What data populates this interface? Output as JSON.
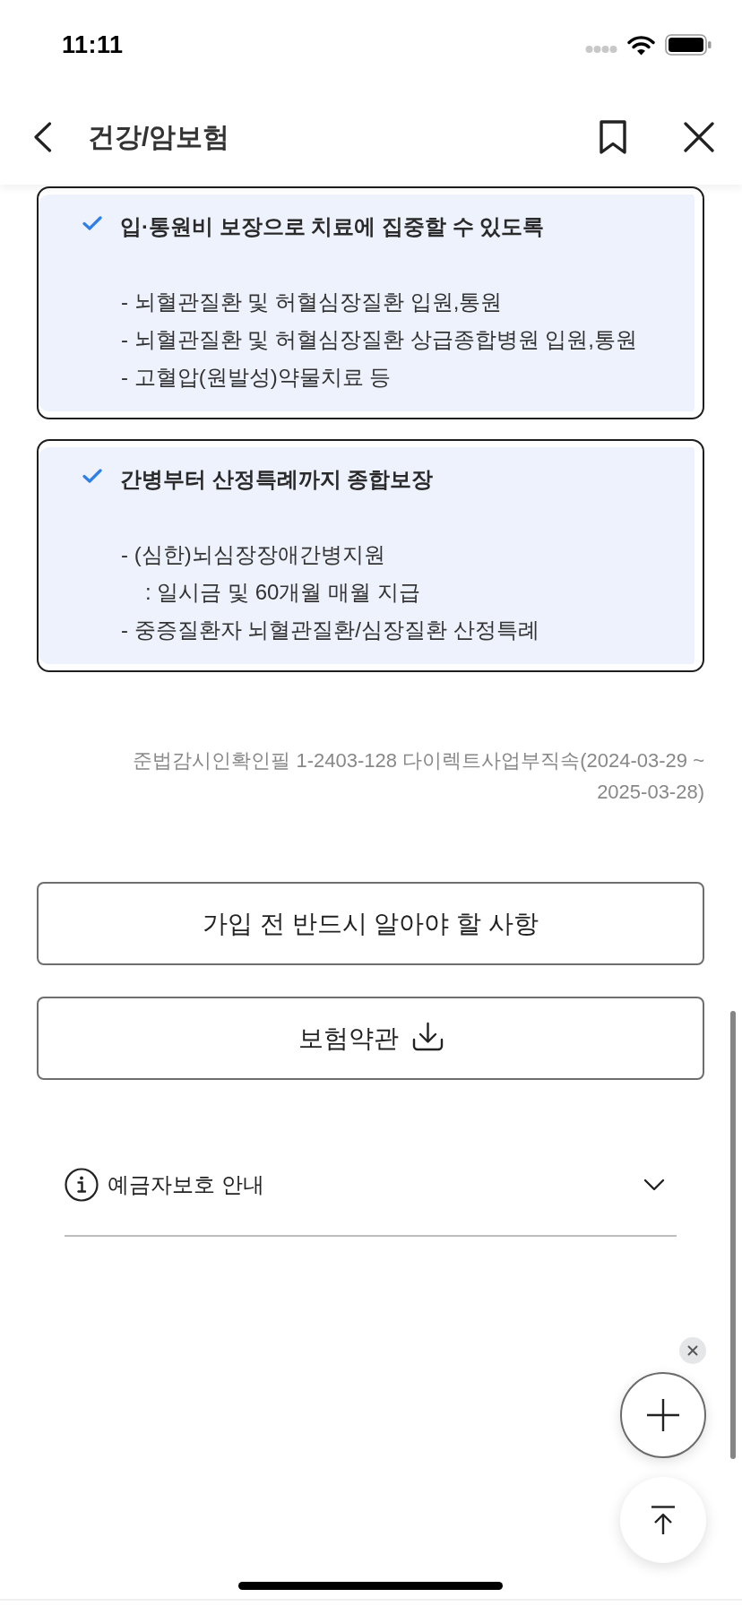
{
  "status_bar": {
    "time": "11:11"
  },
  "header": {
    "title": "건강/암보험",
    "bookmarked": false
  },
  "cards": [
    {
      "title": "입·통원비 보장으로 치료에 집중할 수 있도록",
      "lines": [
        {
          "kind": "bullet",
          "text": "- 뇌혈관질환 및 허혈심장질환 입원,통원"
        },
        {
          "kind": "bullet",
          "text": "- 뇌혈관질환 및 허혈심장질환 상급종합병원 입원,통원"
        },
        {
          "kind": "bullet",
          "text": "- 고혈압(원발성)약물치료 등"
        }
      ]
    },
    {
      "title": "간병부터 산정특례까지 종합보장",
      "lines": [
        {
          "kind": "bullet",
          "text": "- (심한)뇌심장장애간병지원"
        },
        {
          "kind": "sub",
          "text": ": 일시금 및 60개월 매월 지급"
        },
        {
          "kind": "bullet",
          "text": "- 중증질환자 뇌혈관질환/심장질환 산정특례"
        }
      ]
    }
  ],
  "notice": "준법감시인확인필 1-2403-128 다이렉트사업부직속(2024-03-29 ~ 2025-03-28)",
  "buttons": [
    {
      "kind": "plain",
      "label": "가입 전 반드시 알아야 할 사항"
    },
    {
      "kind": "download",
      "label": "보험약관"
    }
  ],
  "disclosure": {
    "label": "예금자보호 안내",
    "expanded": false
  }
}
